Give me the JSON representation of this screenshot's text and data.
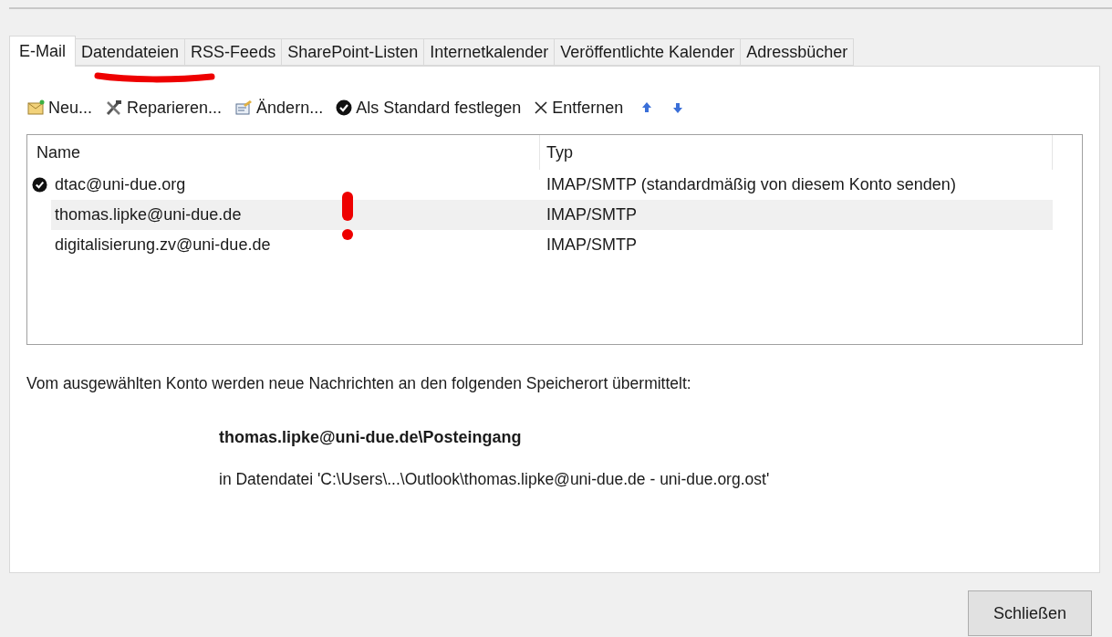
{
  "tabs": [
    {
      "label": "E-Mail",
      "selected": true
    },
    {
      "label": "Datendateien",
      "selected": false
    },
    {
      "label": "RSS-Feeds",
      "selected": false
    },
    {
      "label": "SharePoint-Listen",
      "selected": false
    },
    {
      "label": "Internetkalender",
      "selected": false
    },
    {
      "label": "Veröffentlichte Kalender",
      "selected": false
    },
    {
      "label": "Adressbücher",
      "selected": false
    }
  ],
  "toolbar": [
    {
      "kind": "new",
      "label": "Neu..."
    },
    {
      "kind": "repair",
      "label": "Reparieren..."
    },
    {
      "kind": "change",
      "label": "Ändern..."
    },
    {
      "kind": "default",
      "label": "Als Standard festlegen"
    },
    {
      "kind": "remove",
      "label": "Entfernen"
    },
    {
      "kind": "up"
    },
    {
      "kind": "down"
    }
  ],
  "accounts": {
    "columns": [
      "Name",
      "Typ"
    ],
    "rows": [
      {
        "name": "dtac@uni-due.org",
        "type": "IMAP/SMTP (standardmäßig von diesem Konto senden)",
        "default": true,
        "selected": false
      },
      {
        "name": "thomas.lipke@uni-due.de",
        "type": "IMAP/SMTP",
        "default": false,
        "selected": true
      },
      {
        "name": "digitalisierung.zv@uni-due.de",
        "type": "IMAP/SMTP",
        "default": false,
        "selected": false
      }
    ]
  },
  "delivery": {
    "description": "Vom ausgewählten Konto werden neue Nachrichten an den folgenden Speicherort übermittelt:",
    "folder": "thomas.lipke@uni-due.de\\Posteingang",
    "file": "in Datendatei 'C:\\Users\\...\\Outlook\\thomas.lipke@uni-due.de - uni-due.org.ost'"
  },
  "buttons": [
    "Schließen"
  ]
}
